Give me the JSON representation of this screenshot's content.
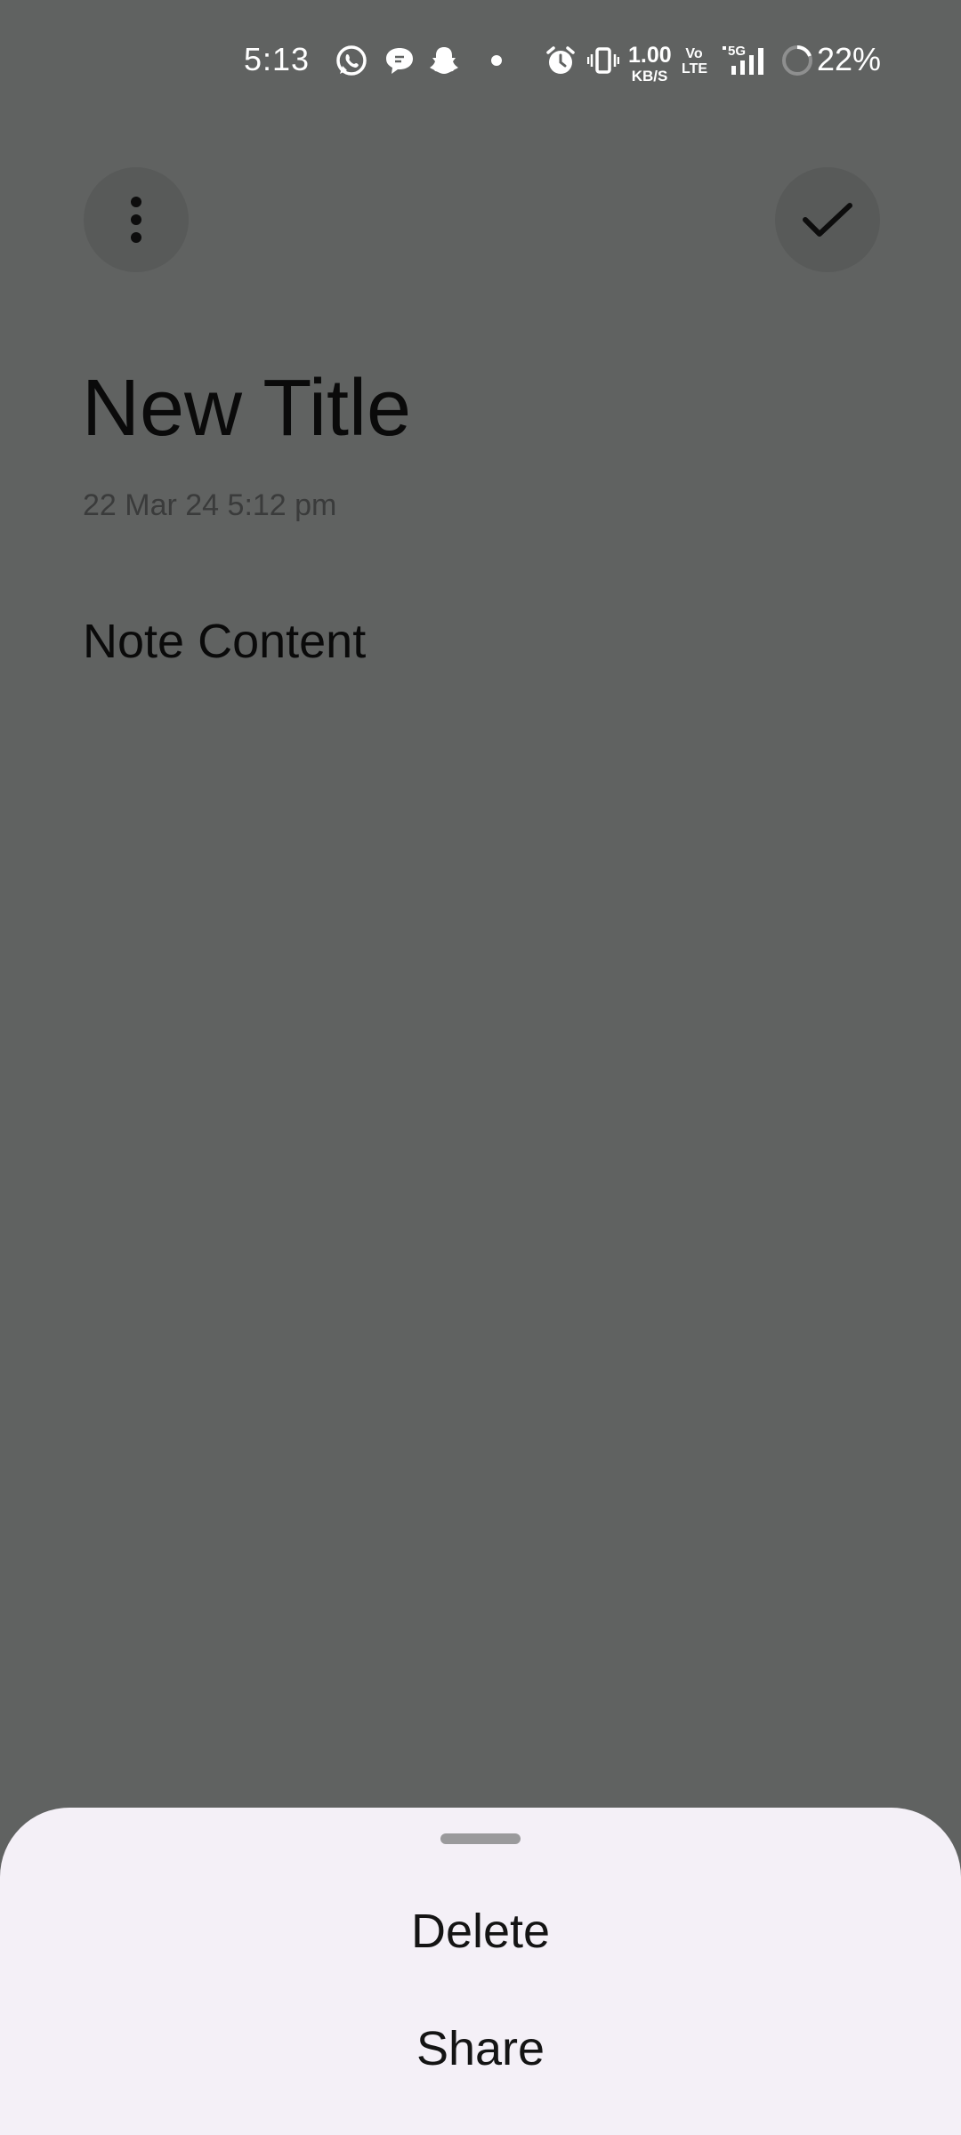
{
  "status_bar": {
    "time": "5:13",
    "net_speed_value": "1.00",
    "net_speed_unit": "KB/S",
    "volte_top": "Vo",
    "volte_bottom": "LTE",
    "network": "5G",
    "battery": "22%",
    "notification_icons": [
      "whatsapp-icon",
      "chat-bubble-icon",
      "snapchat-icon",
      "dot-icon"
    ],
    "system_icons": [
      "alarm-icon",
      "vibrate-icon",
      "signal-icon",
      "battery-saver-ring-icon"
    ]
  },
  "toolbar": {
    "more_icon": "vertical-dots-icon",
    "done_icon": "checkmark-icon"
  },
  "note": {
    "title": "New Title",
    "date": "22 Mar 24  5:12 pm",
    "content": "Note Content"
  },
  "bottom_sheet": {
    "items": [
      {
        "label": "Delete"
      },
      {
        "label": "Share"
      }
    ]
  },
  "colors": {
    "scrim_background": "#606261",
    "sheet_background": "#f4f0f7",
    "button_background": "#585a59"
  }
}
